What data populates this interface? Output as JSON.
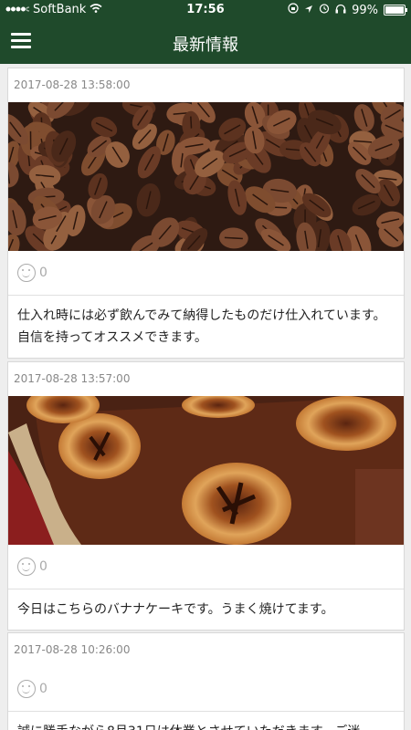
{
  "status": {
    "carrier": "SoftBank",
    "time": "17:56",
    "battery": "99%",
    "battery_level": 0.99
  },
  "header": {
    "title": "最新情報"
  },
  "posts": [
    {
      "time": "2017-08-28 13:58:00",
      "image": "coffee-beans",
      "likes": "0",
      "text": "仕入れ時には必ず飲んでみて納得したものだけ仕入れています。自信を持ってオススメできます。"
    },
    {
      "time": "2017-08-28 13:57:00",
      "image": "banana-cake",
      "likes": "0",
      "text": "今日はこちらのバナナケーキです。うまく焼けてます。"
    },
    {
      "time": "2017-08-28 10:26:00",
      "likes": "0",
      "text": "誠に勝手ながら8月31日は休業とさせていただきます。ご迷"
    }
  ],
  "icons": {
    "menu": "hamburger-menu-icon",
    "like": "smiley-icon",
    "wifi": "wifi-icon",
    "location": "location-arrow-icon",
    "alarm": "alarm-icon",
    "headphones": "headphones-icon",
    "lock": "rotation-lock-icon"
  },
  "colors": {
    "header_bg": "#1f4a2b",
    "page_bg": "#eeeeee"
  }
}
